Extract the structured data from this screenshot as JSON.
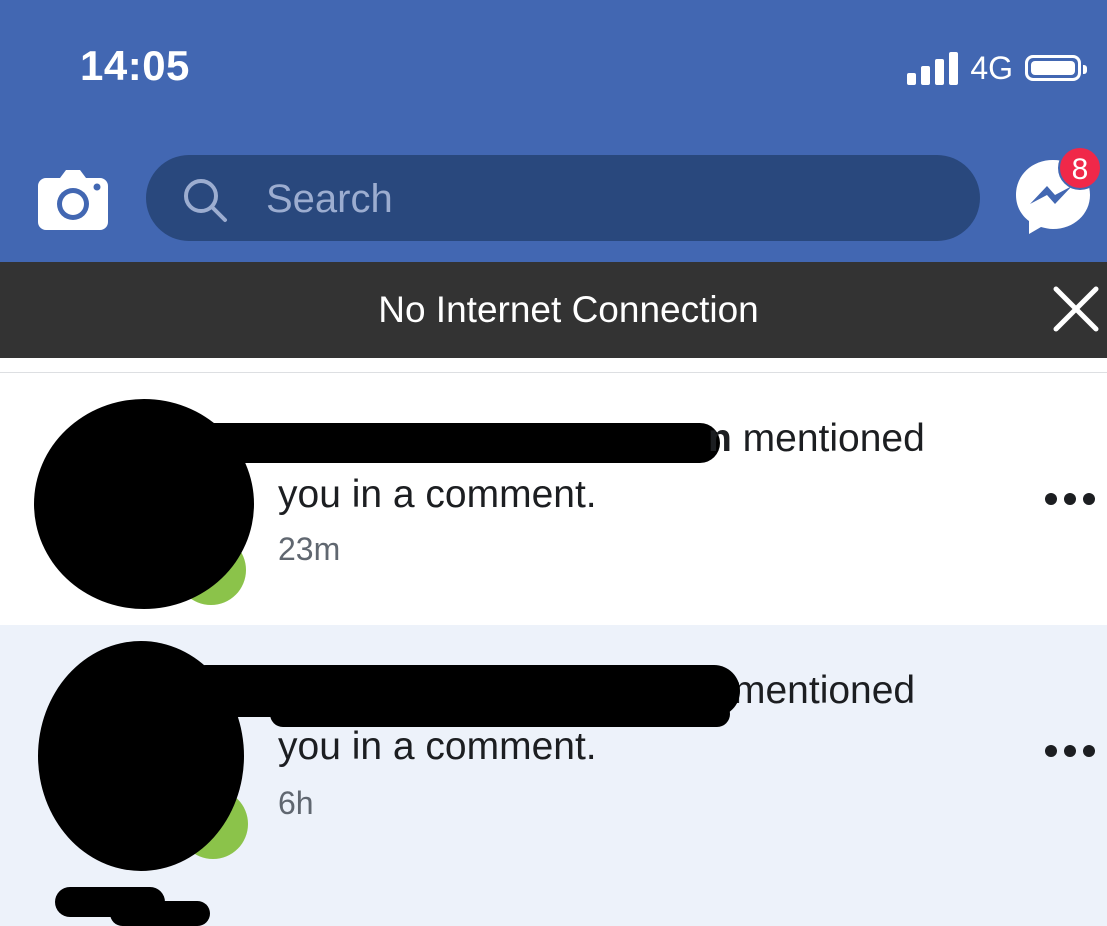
{
  "status_bar": {
    "time": "14:05",
    "network": "4G",
    "signal_bars": 4,
    "battery_level": 1.0
  },
  "header": {
    "camera_icon": "camera-icon",
    "search_placeholder": "Search",
    "search_icon": "search-icon",
    "messenger_icon": "messenger-icon",
    "messenger_badge": "8"
  },
  "offline_banner": {
    "text": "No Internet Connection",
    "close_icon": "close-icon"
  },
  "notifications": [
    {
      "name_tail": "n",
      "action": "mentioned",
      "line2": "you in a comment.",
      "time": "23m",
      "unread": false
    },
    {
      "name_tail": "",
      "action": "mentioned",
      "line2": "you in a comment.",
      "time": "6h",
      "unread": true
    }
  ],
  "colors": {
    "brand_blue": "#4267b2",
    "search_bg": "#29487d",
    "banner_bg": "#333333",
    "unread_bg": "#edf2fa",
    "badge_red": "#f02849"
  }
}
